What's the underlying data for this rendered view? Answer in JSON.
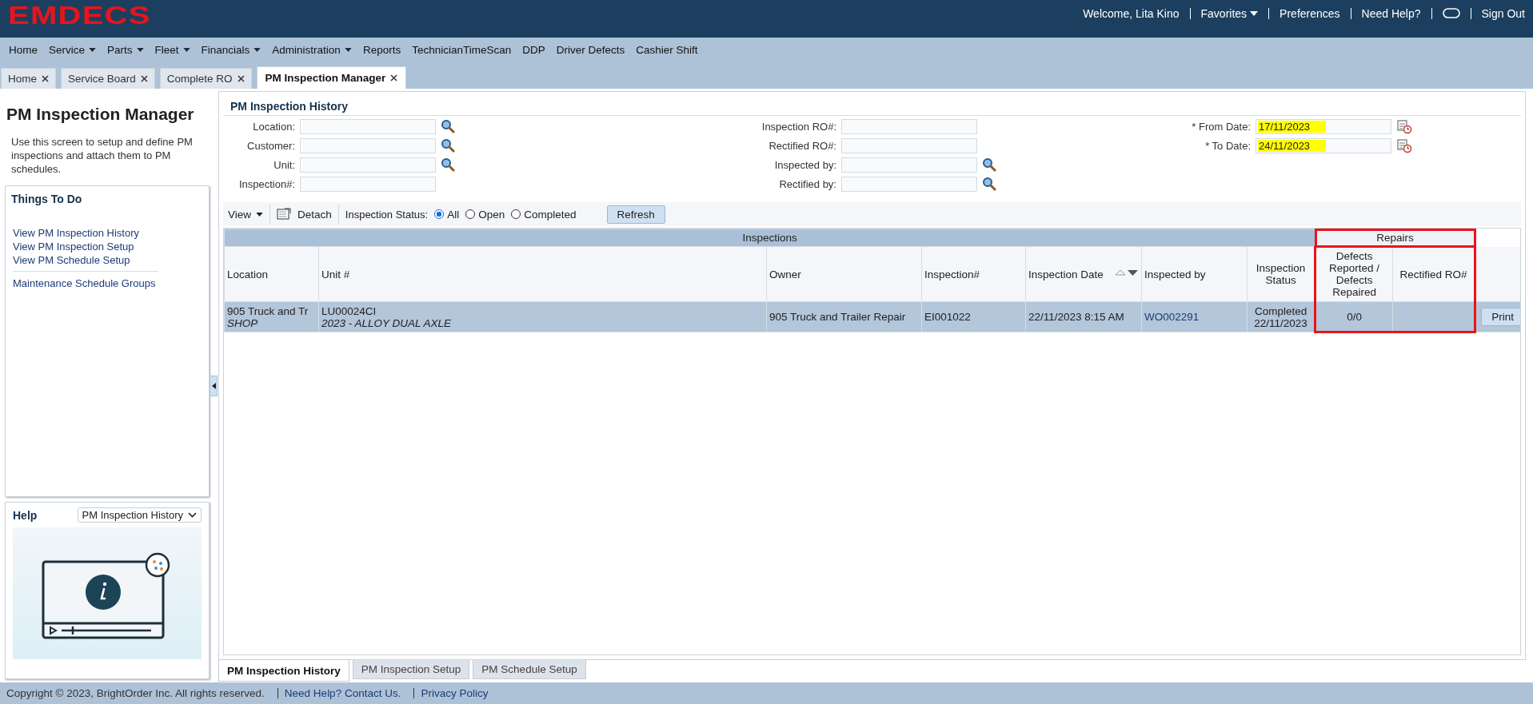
{
  "app": {
    "logo": "EMDECS"
  },
  "header_links": [
    {
      "label": "Welcome, Lita Kino",
      "kind": "text"
    },
    {
      "label": "Favorites",
      "kind": "dropdown"
    },
    {
      "label": "Preferences",
      "kind": "link"
    },
    {
      "label": "Need Help?",
      "kind": "link"
    },
    {
      "kind": "oval"
    },
    {
      "label": "Sign Out",
      "kind": "link"
    }
  ],
  "menu": [
    {
      "label": "Home",
      "dropdown": false
    },
    {
      "label": "Service",
      "dropdown": true
    },
    {
      "label": "Parts",
      "dropdown": true
    },
    {
      "label": "Fleet",
      "dropdown": true
    },
    {
      "label": "Financials",
      "dropdown": true
    },
    {
      "label": "Administration",
      "dropdown": true
    },
    {
      "label": "Reports",
      "dropdown": false
    },
    {
      "label": "TechnicianTimeScan",
      "dropdown": false
    },
    {
      "label": "DDP",
      "dropdown": false
    },
    {
      "label": "Driver Defects",
      "dropdown": false
    },
    {
      "label": "Cashier Shift",
      "dropdown": false
    }
  ],
  "tabs": [
    {
      "label": "Home",
      "selected": false
    },
    {
      "label": "Service Board",
      "selected": false
    },
    {
      "label": "Complete RO",
      "selected": false
    },
    {
      "label": "PM Inspection Manager",
      "selected": true
    }
  ],
  "sidebar": {
    "title": "PM Inspection Manager",
    "description": "Use this screen to setup and define PM inspections and attach them to PM schedules.",
    "things_to_do": {
      "title": "Things To Do",
      "links": [
        "View PM Inspection History",
        "View PM Inspection Setup",
        "View PM Schedule Setup"
      ],
      "extra_links": [
        "Maintenance Schedule Groups"
      ]
    },
    "help": {
      "title": "Help",
      "select": "PM Inspection History"
    }
  },
  "panel": {
    "title": "PM Inspection History",
    "filters_left": [
      {
        "label": "Location:",
        "lookup": true
      },
      {
        "label": "Customer:",
        "lookup": true
      },
      {
        "label": "Unit:",
        "lookup": true
      },
      {
        "label": "Inspection#:",
        "lookup": false
      }
    ],
    "filters_mid": [
      {
        "label": "Inspection RO#:",
        "lookup": false
      },
      {
        "label": "Rectified RO#:",
        "lookup": false
      },
      {
        "label": "Inspected by:",
        "lookup": true
      },
      {
        "label": "Rectified by:",
        "lookup": true
      }
    ],
    "filters_right": [
      {
        "label": "* From Date:",
        "value": "17/11/2023"
      },
      {
        "label": "* To Date:",
        "value": "24/11/2023"
      }
    ],
    "toolbar": {
      "view": "View",
      "detach": "Detach",
      "status_label": "Inspection Status:",
      "options": [
        {
          "label": "All",
          "selected": true
        },
        {
          "label": "Open",
          "selected": false
        },
        {
          "label": "Completed",
          "selected": false
        }
      ],
      "refresh": "Refresh"
    }
  },
  "table": {
    "groups": [
      {
        "label": "Inspections",
        "highlighted": false
      },
      {
        "label": "Repairs",
        "highlighted": true
      }
    ],
    "columns": [
      {
        "label": "Location",
        "sortable": false
      },
      {
        "label": "Unit #",
        "sortable": false
      },
      {
        "label": "Owner",
        "sortable": false
      },
      {
        "label": "Inspection#",
        "sortable": false
      },
      {
        "label": "Inspection Date",
        "sortable": true
      },
      {
        "label": "Inspected by",
        "sortable": false
      },
      {
        "label": "Inspection Status",
        "sortable": false
      },
      {
        "label": "Defects Reported / Defects Repaired",
        "sortable": false
      },
      {
        "label": "Rectified RO#",
        "sortable": false
      },
      {
        "sortable": false
      }
    ],
    "rows": [
      {
        "selected": true,
        "cells": [
          {
            "kind": "text",
            "text": "905 Truck and Tr",
            "sub": "SHOP"
          },
          {
            "kind": "text",
            "text": "LU00024CI",
            "sub": "2023 - ALLOY DUAL AXLE"
          },
          {
            "kind": "text",
            "text": "905 Truck and Trailer Repair"
          },
          {
            "kind": "text",
            "text": "EI001022"
          },
          {
            "kind": "text",
            "text": "22/11/2023 8:15 AM"
          },
          {
            "kind": "link",
            "text": "WO002291"
          },
          {
            "kind": "text",
            "text": "Completed",
            "sub2": "22/11/2023"
          },
          {
            "kind": "text",
            "text": "0/0"
          },
          {
            "kind": "empty"
          },
          {
            "kind": "button",
            "text": "Print"
          }
        ]
      }
    ]
  },
  "bottom_tabs": [
    {
      "label": "PM Inspection History",
      "selected": true
    },
    {
      "label": "PM Inspection Setup",
      "selected": false
    },
    {
      "label": "PM Schedule Setup",
      "selected": false
    }
  ],
  "footer": {
    "copyright": "Copyright © 2023, BrightOrder Inc. All rights reserved.",
    "links": [
      "Need Help? Contact Us.",
      "Privacy Policy"
    ]
  }
}
